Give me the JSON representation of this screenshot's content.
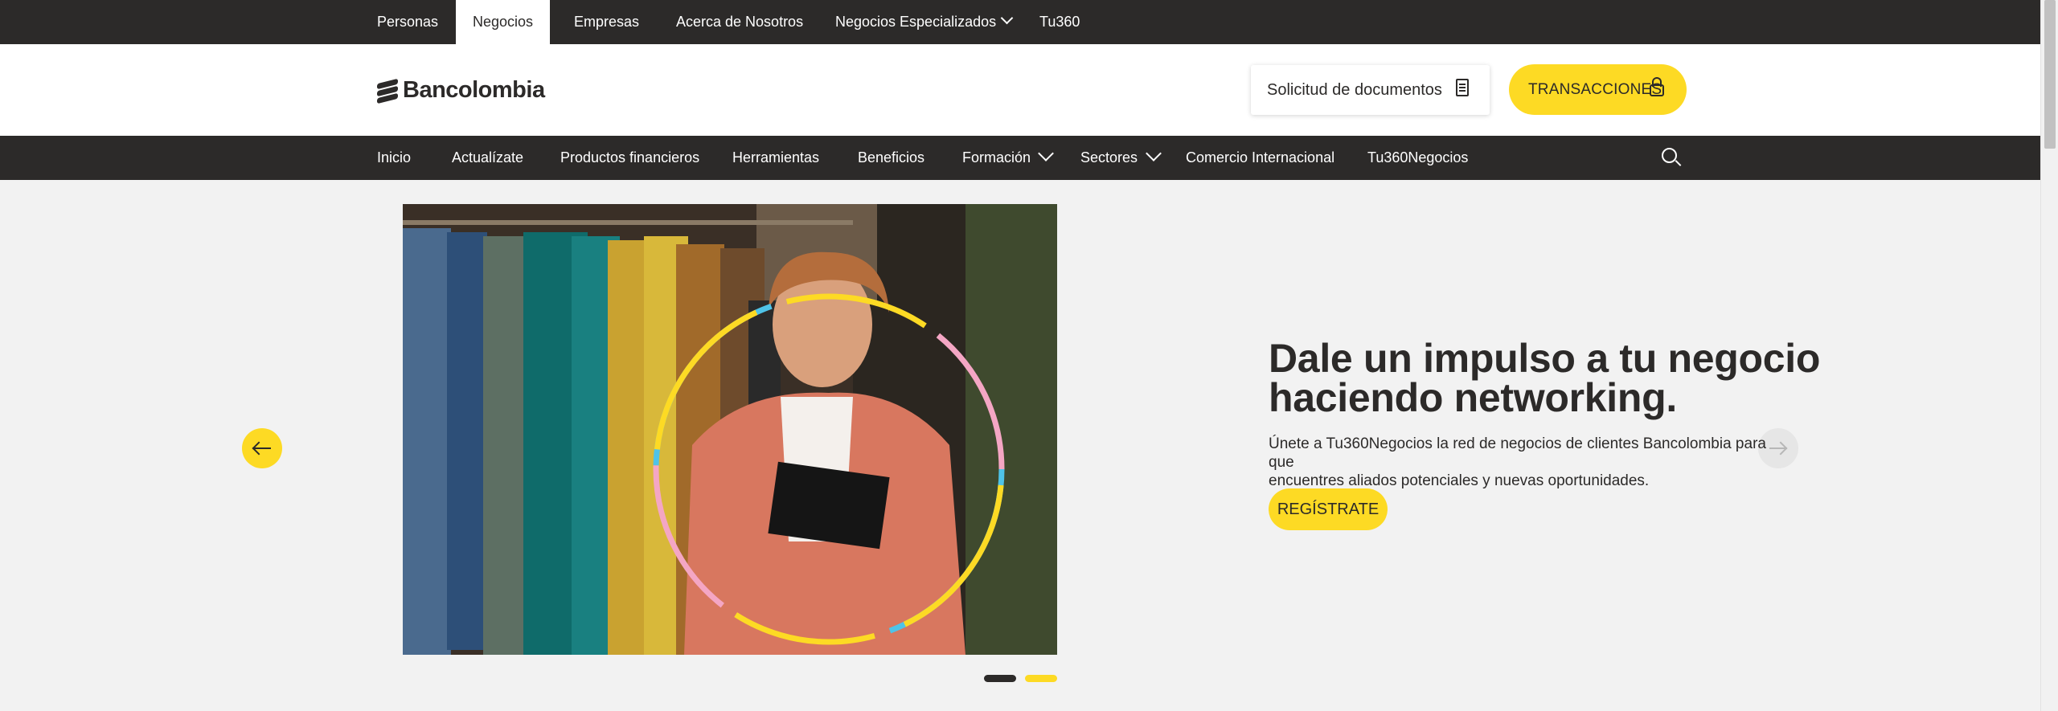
{
  "top_segments": [
    {
      "label": "Personas",
      "active": false
    },
    {
      "label": "Negocios",
      "active": true
    },
    {
      "label": "Empresas",
      "active": false
    },
    {
      "label": "Acerca de Nosotros",
      "active": false
    },
    {
      "label": "Negocios Especializados",
      "active": false,
      "has_dropdown": true
    },
    {
      "label": "Tu360",
      "active": false
    }
  ],
  "header": {
    "logo_text": "Bancolombia",
    "docs_button": "Solicitud de documentos",
    "docs_icon": "document-icon",
    "transactions_button": "TRANSACCIONES",
    "transactions_icon": "lock-icon"
  },
  "nav": {
    "items": [
      {
        "label": "Inicio"
      },
      {
        "label": "Actualízate"
      },
      {
        "label": "Productos financieros"
      },
      {
        "label": "Herramientas"
      },
      {
        "label": "Beneficios"
      },
      {
        "label": "Formación",
        "has_dropdown": true
      },
      {
        "label": "Sectores",
        "has_dropdown": true
      },
      {
        "label": "Comercio Internacional"
      },
      {
        "label": "Tu360Negocios"
      }
    ],
    "search_icon": "search-icon"
  },
  "hero": {
    "title_line1": "Dale un impulso a tu negocio",
    "title_line2": "haciendo networking.",
    "desc_line1": "Únete a Tu360Negocios la red de negocios de clientes Bancolombia para que",
    "desc_line2": "encuentres aliados potenciales y nuevas oportunidades.",
    "cta_label": "REGÍSTRATE",
    "prev_icon": "arrow-left-icon",
    "next_icon": "arrow-right-icon",
    "slides_total": 2,
    "active_slide": 2
  },
  "colors": {
    "brand_yellow": "#fdda24",
    "dark": "#2c2a29",
    "background": "#f2f2f2"
  }
}
